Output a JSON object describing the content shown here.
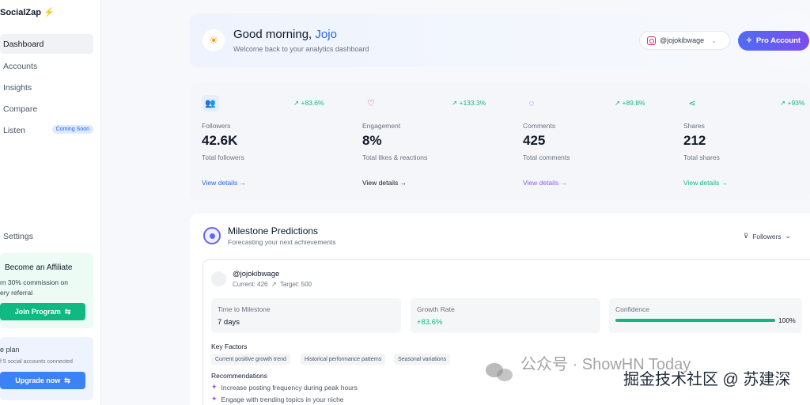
{
  "brand": {
    "name": "SocialZap"
  },
  "sidebar": {
    "items": [
      {
        "label": "Dashboard"
      },
      {
        "label": "Accounts"
      },
      {
        "label": "Insights"
      },
      {
        "label": "Compare"
      },
      {
        "label": "Listen",
        "badge": "Coming Soon"
      }
    ],
    "settings_label": "Settings",
    "affiliate": {
      "title": "Become an Affiliate",
      "desc_line1": "rn 30% commission on",
      "desc_line2": "ery referral",
      "button": "Join Program"
    },
    "plan": {
      "title": "e plan",
      "desc": "f 5 social accounts connected",
      "button": "Upgrade now"
    }
  },
  "header": {
    "greeting": "Good morning,",
    "user": "Jojo",
    "welcome": "Welcome back to your analytics dashboard",
    "account": "@jojokibwage",
    "pro_button": "Pro Account"
  },
  "stats": [
    {
      "label": "Followers",
      "value": "42.6K",
      "sub": "Total followers",
      "trend": "+83.6%",
      "link": "View details",
      "color": "#2563eb"
    },
    {
      "label": "Engagement",
      "value": "8%",
      "sub": "Total likes & reactions",
      "trend": "+133.3%",
      "link": "View details",
      "color": "#111827"
    },
    {
      "label": "Comments",
      "value": "425",
      "sub": "Total comments",
      "trend": "+89.8%",
      "link": "View details",
      "color": "#8b5cf6"
    },
    {
      "label": "Shares",
      "value": "212",
      "sub": "Total shares",
      "trend": "+93%",
      "link": "View details",
      "color": "#10b981"
    }
  ],
  "milestone": {
    "title": "Milestone Predictions",
    "subtitle": "Forecasting your next achievements",
    "filter": "Followers",
    "account": "@jojokibwage",
    "current": "Current: 426",
    "target": "Target: 500",
    "metrics": {
      "time_label": "Time to Milestone",
      "time_value": "7 days",
      "growth_label": "Growth Rate",
      "growth_value": "+83.6%",
      "confidence_label": "Confidence",
      "confidence_value": "100%",
      "confidence_fraction": 1.0
    },
    "key_factors_title": "Key Factors",
    "key_factors": [
      "Current positive growth trend",
      "Historical performance patterns",
      "Seasonal variations"
    ],
    "recommendations_title": "Recommendations",
    "recommendations": [
      "Increase posting frequency during peak hours",
      "Engage with trending topics in your niche"
    ]
  },
  "watermark": {
    "text_a": "公众号 · ShowHN Today",
    "text_b": "掘金技术社区 @ 苏建深"
  }
}
